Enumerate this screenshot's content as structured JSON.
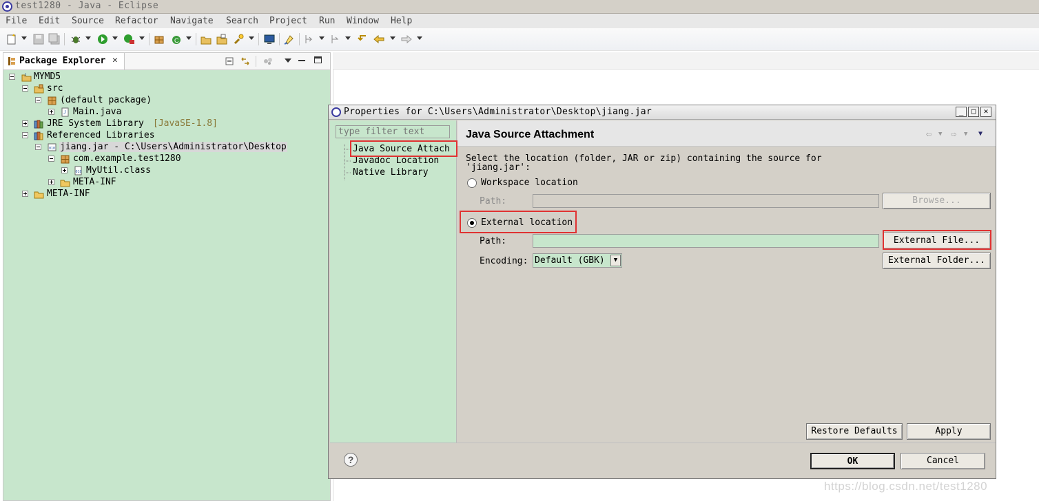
{
  "window": {
    "title": "test1280 - Java - Eclipse"
  },
  "menubar": {
    "items": [
      "File",
      "Edit",
      "Source",
      "Refactor",
      "Navigate",
      "Search",
      "Project",
      "Run",
      "Window",
      "Help"
    ]
  },
  "package_explorer": {
    "tab_label": "Package Explorer",
    "tree": {
      "project": "MYMD5",
      "src": "src",
      "default_package": "(default package)",
      "main_java": "Main.java",
      "jre": "JRE System Library",
      "jre_version": "[JavaSE-1.8]",
      "referenced_libraries": "Referenced Libraries",
      "jar": "jiang.jar - C:\\Users\\Administrator\\Desktop",
      "package": "com.example.test1280",
      "class_file": "MyUtil.class",
      "jar_meta_inf": "META-INF",
      "project_meta_inf": "META-INF"
    }
  },
  "dialog": {
    "title": "Properties for C:\\Users\\Administrator\\Desktop\\jiang.jar",
    "filter_placeholder": "type filter text",
    "nav": [
      "Java Source Attach",
      "Javadoc Location",
      "Native Library"
    ],
    "page_title": "Java Source Attachment",
    "description_line1": "Select the location (folder, JAR or zip) containing the source for",
    "description_line2": "'jiang.jar':",
    "workspace_location_label": "Workspace location",
    "workspace_path_label": "Path:",
    "browse_label": "Browse...",
    "external_location_label": "External location",
    "external_path_label": "Path:",
    "external_path_value": "",
    "external_file_label": "External File...",
    "encoding_label": "Encoding:",
    "encoding_value": "Default (GBK)",
    "external_folder_label": "External Folder...",
    "restore_defaults_label": "Restore Defaults",
    "apply_label": "Apply",
    "ok_label": "OK",
    "cancel_label": "Cancel",
    "selected_location": "external"
  },
  "watermark": "https://blog.csdn.net/test1280",
  "colors": {
    "tree_background": "#c7e6cc",
    "dialog_background": "#d4d0c8",
    "highlight_box": "#e03232"
  }
}
